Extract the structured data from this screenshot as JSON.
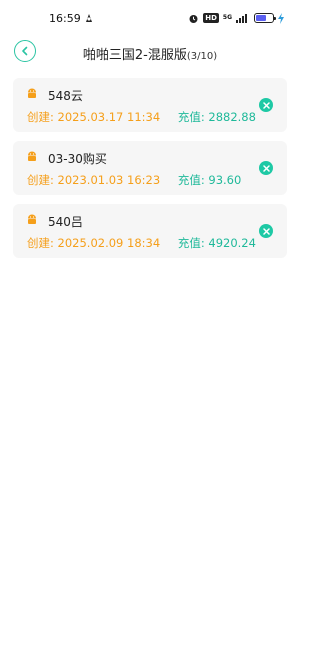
{
  "status_bar": {
    "time": "16:59",
    "hd_badge": "HD",
    "network": "5G",
    "battery_level": 0.6,
    "colors": {
      "battery": "#5b5ff0",
      "charging": "#2d9cdb"
    },
    "icons": [
      "notification-app-icon",
      "alarm-icon",
      "hd-badge",
      "signal-icon",
      "battery-icon",
      "charging-bolt-icon"
    ]
  },
  "header": {
    "title": "啪啪三国2-混服版",
    "count": "(3/10)",
    "back_icon": "chevron-left-circle-icon",
    "accent_color": "#2bc4a3"
  },
  "accounts": [
    {
      "name": "548云",
      "created_label": "创建:",
      "created_at": "2025.03.17 11:34",
      "recharge_label": "充值:",
      "recharge": "2882.88"
    },
    {
      "name": "03-30购买",
      "created_label": "创建:",
      "created_at": "2023.01.03 16:23",
      "recharge_label": "充值:",
      "recharge": "93.60"
    },
    {
      "name": "540吕",
      "created_label": "创建:",
      "created_at": "2025.02.09 18:34",
      "recharge_label": "充值:",
      "recharge": "4920.24"
    }
  ],
  "colors": {
    "created": "#f59f1a",
    "recharge": "#1fb99a",
    "delete_button": "#1ec9a5",
    "android_icon": "#f59f1a",
    "card_background": "#f6f6f6"
  }
}
